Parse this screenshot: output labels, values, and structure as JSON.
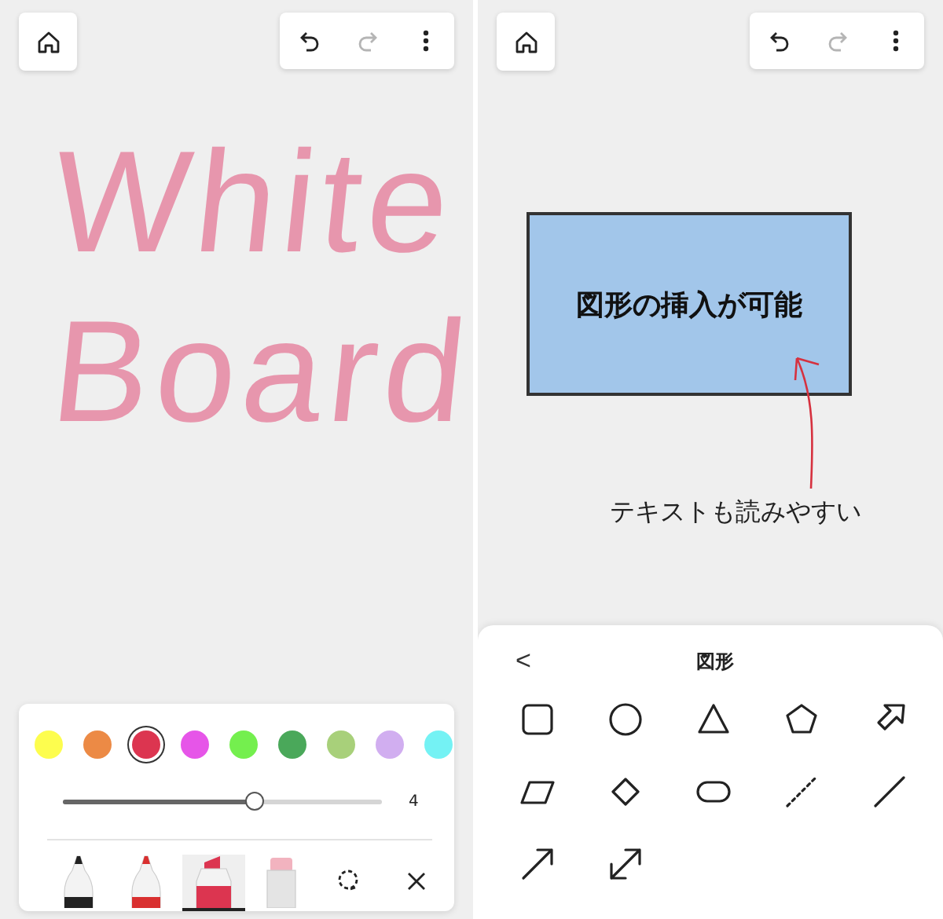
{
  "screens": [
    {
      "toolbar": [
        {
          "kind": "undo",
          "disabled": false
        },
        {
          "kind": "redo",
          "disabled": true
        },
        {
          "kind": "more",
          "disabled": false
        }
      ],
      "handwriting": [
        "White",
        "Board"
      ],
      "palette": {
        "colors": [
          {
            "color": "#fdfd4e",
            "selected": false
          },
          {
            "color": "#ec8a45",
            "selected": false
          },
          {
            "color": "#dc3550",
            "selected": true
          },
          {
            "color": "#e655e8",
            "selected": false
          },
          {
            "color": "#74ef4e",
            "selected": false
          },
          {
            "color": "#4aa85a",
            "selected": false
          },
          {
            "color": "#a8d07a",
            "selected": false
          },
          {
            "color": "#d1aef0",
            "selected": false
          },
          {
            "color": "#74f2f4",
            "selected": false
          }
        ],
        "width": {
          "level": 0.6,
          "reading": "4"
        },
        "tools": [
          {
            "kind": "pen",
            "color": "#222222",
            "selected": false
          },
          {
            "kind": "pen",
            "color": "#d93030",
            "selected": false
          },
          {
            "kind": "marker",
            "color": "#dc3550",
            "selected": true
          },
          {
            "kind": "eraser",
            "selected": false
          },
          {
            "kind": "lasso",
            "selected": false
          },
          {
            "kind": "close",
            "selected": false
          }
        ]
      }
    },
    {
      "toolbar": [
        {
          "kind": "undo",
          "disabled": false
        },
        {
          "kind": "redo",
          "disabled": true
        },
        {
          "kind": "more",
          "disabled": false
        }
      ],
      "shape_text": "図形の挿入が可能",
      "caption": "テキストも読みやすい",
      "sheet": {
        "back": "<",
        "title": "図形",
        "shapes": [
          {
            "kind": "square"
          },
          {
            "kind": "circle"
          },
          {
            "kind": "triangle"
          },
          {
            "kind": "pentagon"
          },
          {
            "kind": "arrow-block"
          },
          {
            "kind": "parallelogram"
          },
          {
            "kind": "diamond"
          },
          {
            "kind": "pill"
          },
          {
            "kind": "dashed-line"
          },
          {
            "kind": "line"
          },
          {
            "kind": "arrow"
          },
          {
            "kind": "double-arrow"
          }
        ]
      }
    }
  ]
}
